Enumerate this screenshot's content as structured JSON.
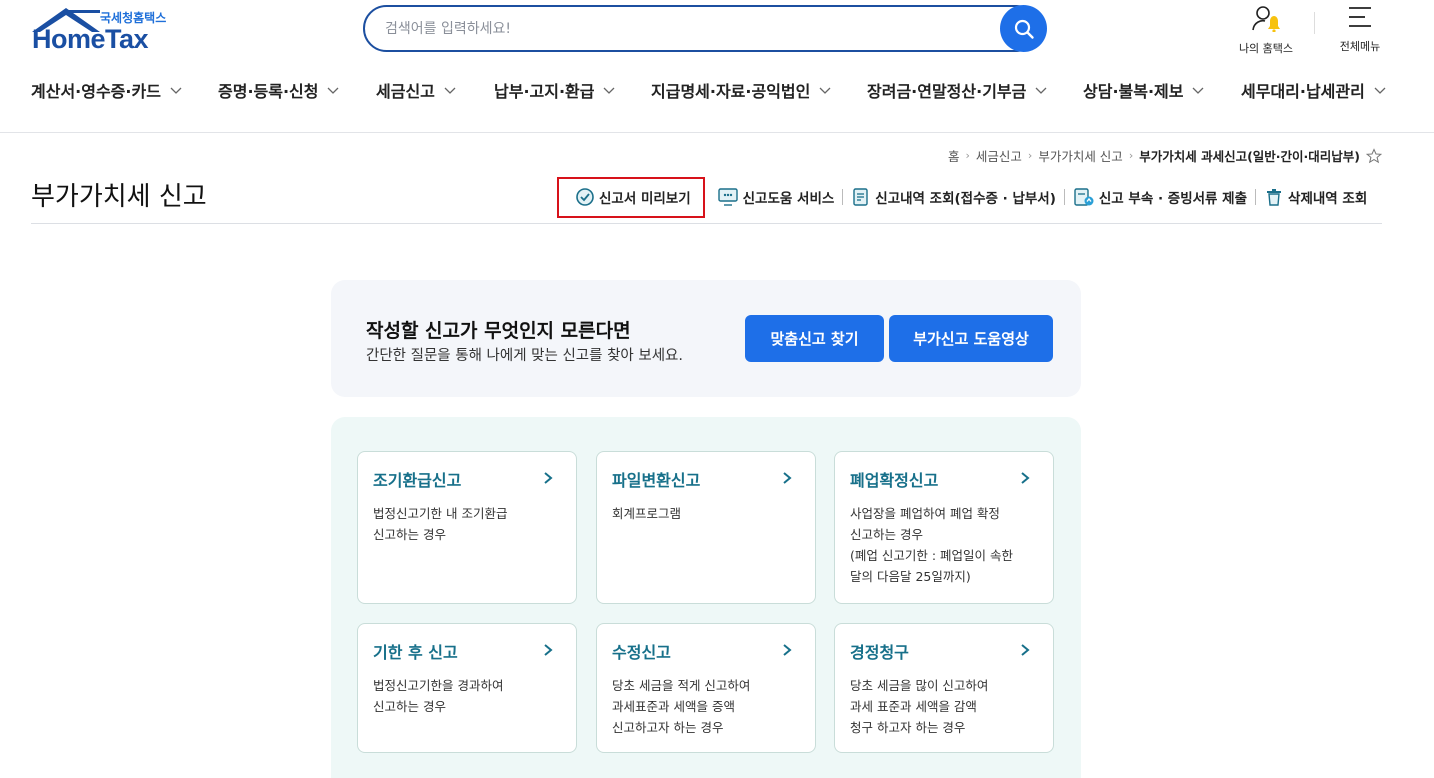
{
  "header": {
    "logo_sub": "국세청홈택스",
    "logo_main": "HomeTax",
    "search_placeholder": "검색어를 입력하세요!",
    "my_hometax": "나의 홈택스",
    "all_menu": "전체메뉴"
  },
  "gnb": [
    {
      "label": "계산서·영수증·카드"
    },
    {
      "label": "증명·등록·신청"
    },
    {
      "label": "세금신고"
    },
    {
      "label": "납부·고지·환급"
    },
    {
      "label": "지급명세·자료·공익법인"
    },
    {
      "label": "장려금·연말정산·기부금"
    },
    {
      "label": "상담·불복·제보"
    },
    {
      "label": "세무대리·납세관리"
    }
  ],
  "breadcrumb": [
    "홈",
    "세금신고",
    "부가가치세 신고",
    "부가가치세 과세신고(일반·간이·대리납부)"
  ],
  "page_title": "부가가치세 신고",
  "quick_links": [
    {
      "label": "신고서 미리보기",
      "icon": "preview-check-icon"
    },
    {
      "label": "신고도움 서비스",
      "icon": "monitor-help-icon"
    },
    {
      "label": "신고내역 조회(접수증 · 납부서)",
      "icon": "document-list-icon"
    },
    {
      "label": "신고 부속 · 증빙서류 제출",
      "icon": "document-upload-icon"
    },
    {
      "label": "삭제내역 조회",
      "icon": "trash-icon"
    }
  ],
  "recommend": {
    "title": "작성할 신고가 무엇인지 모른다면",
    "subtitle": "간단한 질문을 통해 나에게 맞는 신고를 찾아 보세요.",
    "btn_find": "맞춤신고 찾기",
    "btn_video": "부가신고 도움영상"
  },
  "cards": [
    {
      "title": "조기환급신고",
      "desc": [
        "법정신고기한 내 조기환급",
        "신고하는 경우"
      ]
    },
    {
      "title": "파일변환신고",
      "desc": [
        "회계프로그램"
      ]
    },
    {
      "title": "폐업확정신고",
      "desc": [
        "사업장을 폐업하여 폐업 확정",
        "신고하는 경우",
        "(폐업 신고기한 : 폐업일이 속한",
        "달의 다음달 25일까지)"
      ]
    },
    {
      "title": "기한 후 신고",
      "desc": [
        "법정신고기한을 경과하여",
        "신고하는 경우"
      ]
    },
    {
      "title": "수정신고",
      "desc": [
        "당초 세금을 적게 신고하여",
        "과세표준과 세액을 증액",
        "신고하고자 하는 경우"
      ]
    },
    {
      "title": "경정청구",
      "desc": [
        "당초 세금을 많이 신고하여",
        "과세 표준과 세액을 감액",
        "청구 하고자 하는 경우"
      ]
    }
  ],
  "colors": {
    "brand_blue": "#1e6fe8",
    "card_title": "#17708a",
    "highlight_border": "#d7121a"
  }
}
